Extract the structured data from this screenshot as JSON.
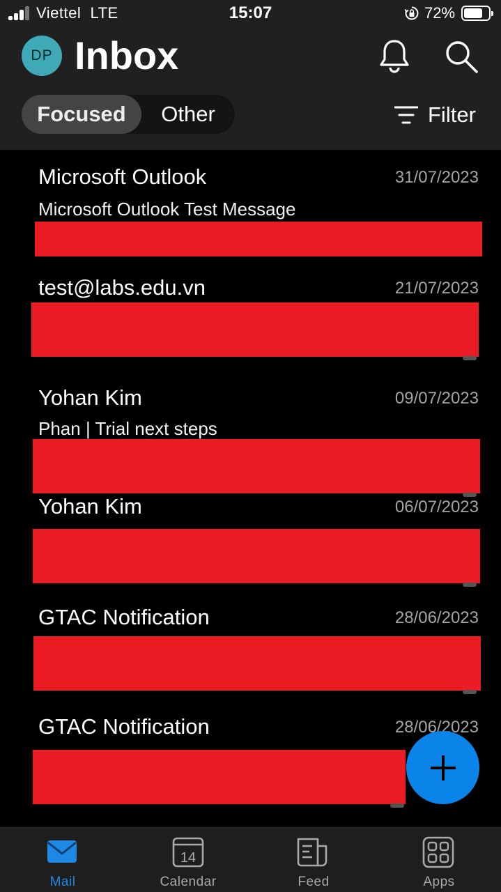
{
  "status_bar": {
    "carrier": "Viettel",
    "network": "LTE",
    "time": "15:07",
    "battery_percent": "72%"
  },
  "header": {
    "avatar_initials": "DP",
    "title": "Inbox",
    "tabs": {
      "focused": "Focused",
      "other": "Other"
    },
    "filter_label": "Filter"
  },
  "messages": [
    {
      "sender": "Microsoft Outlook",
      "date": "31/07/2023",
      "subject": "Microsoft Outlook Test Message"
    },
    {
      "sender": "test@labs.edu.vn",
      "date": "21/07/2023",
      "subject": ""
    },
    {
      "sender": "Yohan Kim",
      "date": "09/07/2023",
      "subject": "Phan | Trial next steps"
    },
    {
      "sender": "Yohan Kim",
      "date": "06/07/2023",
      "subject": ""
    },
    {
      "sender": "GTAC Notification",
      "date": "28/06/2023",
      "subject": ""
    },
    {
      "sender": "GTAC Notification",
      "date": "28/06/2023",
      "subject": ""
    }
  ],
  "tabbar": {
    "mail": "Mail",
    "calendar": "Calendar",
    "calendar_day": "14",
    "feed": "Feed",
    "apps": "Apps"
  },
  "colors": {
    "accent": "#1e88e5",
    "fab": "#0a84e8",
    "redaction": "#ec1c24",
    "avatar": "#3fa9b5"
  }
}
